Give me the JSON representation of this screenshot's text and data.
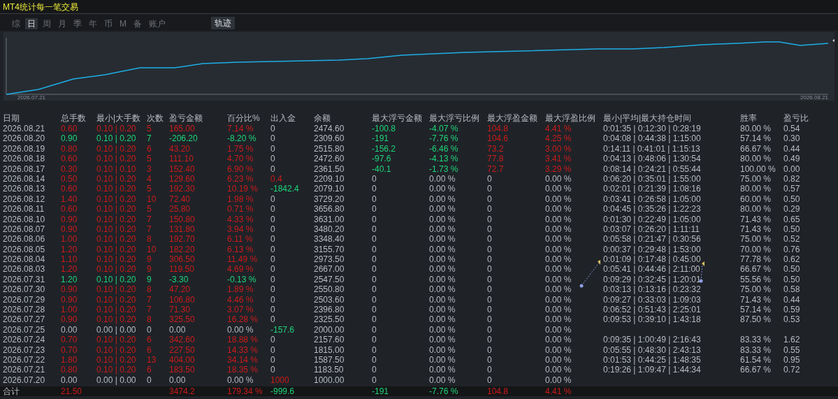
{
  "window": {
    "title": "MT4统计每一笔交易"
  },
  "tabs": [
    {
      "label": "综",
      "selected": false
    },
    {
      "label": "日",
      "selected": true
    },
    {
      "label": "周",
      "selected": false
    },
    {
      "label": "月",
      "selected": false
    },
    {
      "label": "季",
      "selected": false
    },
    {
      "label": "年",
      "selected": false
    },
    {
      "label": "币",
      "selected": false
    },
    {
      "label": "M",
      "selected": false
    },
    {
      "label": "备",
      "selected": false
    },
    {
      "label": "账户",
      "selected": false
    }
  ],
  "view_tabs": [
    {
      "label": "轨迹",
      "selected": true
    }
  ],
  "equity_chart": {
    "start_label": "2026.07.21",
    "end_label": "2026.08.21"
  },
  "table": {
    "columns": [
      "日期",
      "总手数",
      "最小|大手数",
      "次数",
      "盈亏金额",
      "百分比%",
      "出入金",
      "余额",
      "最大浮亏金额",
      "最大浮亏比例",
      "最大浮盈金额",
      "最大浮盈比例",
      "最小|平均|最大持仓时间",
      "胜率",
      "盈亏比"
    ],
    "rows": [
      {
        "date": "2026.08.21",
        "color": "#cc1a1a",
        "lots": "0.60",
        "minmax": "0.10 | 0.20",
        "count": "5",
        "pnl": "165.00",
        "pct": "7.14 %",
        "cash": {
          "text": "0"
        },
        "balance": "2474.60",
        "float_loss": {
          "amount": "-100.8",
          "ratio": "-4.07 %",
          "color": "#1ed47a"
        },
        "float_gain": {
          "amount": "104.8",
          "ratio": "4.41 %",
          "color": "#cc1a1a"
        },
        "hold": "0:01:35 | 0:12:30 | 0:28:19",
        "win": "80.00 %",
        "ratio": "0.54"
      },
      {
        "date": "2026.08.20",
        "color": "#1ed47a",
        "lots": "0.90",
        "minmax": "0.10 | 0.20",
        "count": "7",
        "pnl": "-206.20",
        "pct": "-8.20 %",
        "cash": {
          "text": "0"
        },
        "balance": "2309.60",
        "float_loss": {
          "amount": "-191",
          "ratio": "-7.76 %",
          "color": "#1ed47a"
        },
        "float_gain": {
          "amount": "104.6",
          "ratio": "4.25 %",
          "color": "#cc1a1a"
        },
        "hold": "0:04:08 | 0:44:38 | 1:15:00",
        "win": "57.14 %",
        "ratio": "0.30"
      },
      {
        "date": "2026.08.19",
        "color": "#cc1a1a",
        "lots": "0.80",
        "minmax": "0.10 | 0.20",
        "count": "6",
        "pnl": "43.20",
        "pct": "1.75 %",
        "cash": {
          "text": "0"
        },
        "balance": "2515.80",
        "float_loss": {
          "amount": "-156.2",
          "ratio": "-6.46 %",
          "color": "#1ed47a"
        },
        "float_gain": {
          "amount": "73.2",
          "ratio": "3.00 %",
          "color": "#cc1a1a"
        },
        "hold": "0:14:11 | 0:41:01 | 1:15:13",
        "win": "66.67 %",
        "ratio": "0.44"
      },
      {
        "date": "2026.08.18",
        "color": "#cc1a1a",
        "lots": "0.60",
        "minmax": "0.10 | 0.20",
        "count": "5",
        "pnl": "111.10",
        "pct": "4.70 %",
        "cash": {
          "text": "0"
        },
        "balance": "2472.60",
        "float_loss": {
          "amount": "-97.6",
          "ratio": "-4.13 %",
          "color": "#1ed47a"
        },
        "float_gain": {
          "amount": "77.8",
          "ratio": "3.41 %",
          "color": "#cc1a1a"
        },
        "hold": "0:04:13 | 0:48:06 | 1:30:54",
        "win": "80.00 %",
        "ratio": "0.49"
      },
      {
        "date": "2026.08.17",
        "color": "#cc1a1a",
        "lots": "0.30",
        "minmax": "0.10 | 0.10",
        "count": "3",
        "pnl": "152.40",
        "pct": "6.90 %",
        "cash": {
          "text": "0"
        },
        "balance": "2361.50",
        "float_loss": {
          "amount": "-40.1",
          "ratio": "-1.73 %",
          "color": "#1ed47a"
        },
        "float_gain": {
          "amount": "72.7",
          "ratio": "3.29 %",
          "color": "#cc1a1a"
        },
        "hold": "0:08:14 | 0:24:21 | 0:55:44",
        "win": "100.00 %",
        "ratio": "0.00"
      },
      {
        "date": "2026.08.14",
        "color": "#cc1a1a",
        "lots": "0.50",
        "minmax": "0.10 | 0.20",
        "count": "4",
        "pnl": "129.60",
        "pct": "6.23 %",
        "cash": {
          "text": "0.4",
          "color": "#cc1a1a"
        },
        "balance": "2209.10",
        "float_loss": {
          "amount": "0",
          "ratio": "0.00 %"
        },
        "float_gain": {
          "amount": "0",
          "ratio": "0.00 %"
        },
        "hold": "0:06:20 | 0:35:01 | 1:55:00",
        "win": "75.00 %",
        "ratio": "0.82"
      },
      {
        "date": "2026.08.13",
        "color": "#cc1a1a",
        "lots": "0.60",
        "minmax": "0.10 | 0.20",
        "count": "5",
        "pnl": "192.30",
        "pct": "10.19 %",
        "cash": {
          "text": "-1842.4",
          "color": "#1ed47a"
        },
        "balance": "2079.10",
        "float_loss": {
          "amount": "0",
          "ratio": "0.00 %"
        },
        "float_gain": {
          "amount": "0",
          "ratio": "0.00 %"
        },
        "hold": "0:02:01 | 0:21:39 | 1:08:16",
        "win": "80.00 %",
        "ratio": "0.57"
      },
      {
        "date": "2026.08.12",
        "color": "#cc1a1a",
        "lots": "1.40",
        "minmax": "0.10 | 0.20",
        "count": "10",
        "pnl": "72.40",
        "pct": "1.98 %",
        "cash": {
          "text": "0"
        },
        "balance": "3729.20",
        "float_loss": {
          "amount": "0",
          "ratio": "0.00 %"
        },
        "float_gain": {
          "amount": "0",
          "ratio": "0.00 %"
        },
        "hold": "0:03:41 | 0:26:58 | 1:05:00",
        "win": "60.00 %",
        "ratio": "0.50"
      },
      {
        "date": "2026.08.11",
        "color": "#cc1a1a",
        "lots": "0.60",
        "minmax": "0.10 | 0.20",
        "count": "5",
        "pnl": "25.80",
        "pct": "0.71 %",
        "cash": {
          "text": "0"
        },
        "balance": "3656.80",
        "float_loss": {
          "amount": "0",
          "ratio": "0.00 %"
        },
        "float_gain": {
          "amount": "0",
          "ratio": "0.00 %"
        },
        "hold": "0:04:45 | 0:35:26 | 1:22:23",
        "win": "80.00 %",
        "ratio": "0.29"
      },
      {
        "date": "2026.08.10",
        "color": "#cc1a1a",
        "lots": "0.90",
        "minmax": "0.10 | 0.20",
        "count": "7",
        "pnl": "150.80",
        "pct": "4.33 %",
        "cash": {
          "text": "0"
        },
        "balance": "3631.00",
        "float_loss": {
          "amount": "0",
          "ratio": "0.00 %"
        },
        "float_gain": {
          "amount": "0",
          "ratio": "0.00 %"
        },
        "hold": "0:01:30 | 0:22:49 | 1:05:00",
        "win": "71.43 %",
        "ratio": "0.65"
      },
      {
        "date": "2026.08.07",
        "color": "#cc1a1a",
        "lots": "0.90",
        "minmax": "0.10 | 0.20",
        "count": "7",
        "pnl": "131.80",
        "pct": "3.94 %",
        "cash": {
          "text": "0"
        },
        "balance": "3480.20",
        "float_loss": {
          "amount": "0",
          "ratio": "0.00 %"
        },
        "float_gain": {
          "amount": "0",
          "ratio": "0.00 %"
        },
        "hold": "0:03:07 | 0:26:20 | 1:11:11",
        "win": "71.43 %",
        "ratio": "0.50"
      },
      {
        "date": "2026.08.06",
        "color": "#cc1a1a",
        "lots": "1.00",
        "minmax": "0.10 | 0.20",
        "count": "8",
        "pnl": "192.70",
        "pct": "6.11 %",
        "cash": {
          "text": "0"
        },
        "balance": "3348.40",
        "float_loss": {
          "amount": "0",
          "ratio": "0.00 %"
        },
        "float_gain": {
          "amount": "0",
          "ratio": "0.00 %"
        },
        "hold": "0:05:58 | 0:21:47 | 0:30:56",
        "win": "75.00 %",
        "ratio": "0.52"
      },
      {
        "date": "2026.08.05",
        "color": "#cc1a1a",
        "lots": "1.20",
        "minmax": "0.10 | 0.20",
        "count": "10",
        "pnl": "182.20",
        "pct": "6.13 %",
        "cash": {
          "text": "0"
        },
        "balance": "3155.70",
        "float_loss": {
          "amount": "0",
          "ratio": "0.00 %"
        },
        "float_gain": {
          "amount": "0",
          "ratio": "0.00 %"
        },
        "hold": "0:00:37 | 0:29:48 | 1:53:00",
        "win": "70.00 %",
        "ratio": "0.76"
      },
      {
        "date": "2026.08.04",
        "color": "#cc1a1a",
        "lots": "1.10",
        "minmax": "0.10 | 0.20",
        "count": "9",
        "pnl": "306.50",
        "pct": "11.49 %",
        "cash": {
          "text": "0"
        },
        "balance": "2973.50",
        "float_loss": {
          "amount": "0",
          "ratio": "0.00 %"
        },
        "float_gain": {
          "amount": "0",
          "ratio": "0.00 %"
        },
        "hold": "0:01:09 | 0:17:48 | 0:45:00",
        "win": "77.78 %",
        "ratio": "0.62"
      },
      {
        "date": "2026.08.03",
        "color": "#cc1a1a",
        "lots": "1.20",
        "minmax": "0.10 | 0.20",
        "count": "9",
        "pnl": "119.50",
        "pct": "4.69 %",
        "cash": {
          "text": "0"
        },
        "balance": "2667.00",
        "float_loss": {
          "amount": "0",
          "ratio": "0.00 %"
        },
        "float_gain": {
          "amount": "0",
          "ratio": "0.00 %"
        },
        "hold": "0:05:41 | 0:44:46 | 2:11:00",
        "win": "66.67 %",
        "ratio": "0.50"
      },
      {
        "date": "2026.07.31",
        "color": "#1ed47a",
        "lots": "1.20",
        "minmax": "0.10 | 0.20",
        "count": "9",
        "pnl": "-3.30",
        "pct": "-0.13 %",
        "cash": {
          "text": "0"
        },
        "balance": "2547.50",
        "float_loss": {
          "amount": "0",
          "ratio": "0.00 %"
        },
        "float_gain": {
          "amount": "0",
          "ratio": "0.00 %"
        },
        "hold": "0:09:29 | 0:32:45 | 1:20:01",
        "win": "55.56 %",
        "ratio": "0.50"
      },
      {
        "date": "2026.07.30",
        "color": "#cc1a1a",
        "lots": "0.90",
        "minmax": "0.10 | 0.20",
        "count": "8",
        "pnl": "47.20",
        "pct": "1.89 %",
        "cash": {
          "text": "0"
        },
        "balance": "2550.80",
        "float_loss": {
          "amount": "0",
          "ratio": "0.00 %"
        },
        "float_gain": {
          "amount": "0",
          "ratio": "0.00 %"
        },
        "hold": "0:03:13 | 0:13:16 | 0:23:32",
        "win": "75.00 %",
        "ratio": "0.58"
      },
      {
        "date": "2026.07.29",
        "color": "#cc1a1a",
        "lots": "0.90",
        "minmax": "0.10 | 0.20",
        "count": "7",
        "pnl": "106.80",
        "pct": "4.46 %",
        "cash": {
          "text": "0"
        },
        "balance": "2503.60",
        "float_loss": {
          "amount": "0",
          "ratio": "0.00 %"
        },
        "float_gain": {
          "amount": "0",
          "ratio": "0.00 %"
        },
        "hold": "0:09:27 | 0:33:03 | 1:09:03",
        "win": "71.43 %",
        "ratio": "0.44"
      },
      {
        "date": "2026.07.28",
        "color": "#cc1a1a",
        "lots": "1.00",
        "minmax": "0.10 | 0.20",
        "count": "7",
        "pnl": "71.30",
        "pct": "3.07 %",
        "cash": {
          "text": "0"
        },
        "balance": "2396.80",
        "float_loss": {
          "amount": "0",
          "ratio": "0.00 %"
        },
        "float_gain": {
          "amount": "0",
          "ratio": "0.00 %"
        },
        "hold": "0:06:52 | 0:51:43 | 2:25:01",
        "win": "57.14 %",
        "ratio": "0.59"
      },
      {
        "date": "2026.07.27",
        "color": "#cc1a1a",
        "lots": "0.90",
        "minmax": "0.10 | 0.20",
        "count": "8",
        "pnl": "325.50",
        "pct": "16.28 %",
        "cash": {
          "text": "0"
        },
        "balance": "2325.50",
        "float_loss": {
          "amount": "0",
          "ratio": "0.00 %"
        },
        "float_gain": {
          "amount": "0",
          "ratio": "0.00 %"
        },
        "hold": "0:09:53 | 0:39:10 | 1:43:18",
        "win": "87.50 %",
        "ratio": "0.53"
      },
      {
        "date": "2026.07.25",
        "color": "#b8bcc2",
        "lots": "0.00",
        "minmax": "0.00 | 0.00",
        "count": "0",
        "pnl": "0.00",
        "pct": "0.00 %",
        "cash": {
          "text": "-157.6",
          "color": "#1ed47a"
        },
        "balance": "2000.00",
        "float_loss": {
          "amount": "0",
          "ratio": "0.00 %"
        },
        "float_gain": {
          "amount": "0",
          "ratio": "0.00 %"
        }
      },
      {
        "date": "2026.07.24",
        "color": "#cc1a1a",
        "lots": "0.70",
        "minmax": "0.10 | 0.20",
        "count": "6",
        "pnl": "342.60",
        "pct": "18.88 %",
        "cash": {
          "text": "0"
        },
        "balance": "2157.60",
        "float_loss": {
          "amount": "0",
          "ratio": "0.00 %"
        },
        "float_gain": {
          "amount": "0",
          "ratio": "0.00 %"
        },
        "hold": "0:09:35 | 1:00:49 | 2:16:43",
        "win": "83.33 %",
        "ratio": "1.62"
      },
      {
        "date": "2026.07.23",
        "color": "#cc1a1a",
        "lots": "0.70",
        "minmax": "0.10 | 0.20",
        "count": "6",
        "pnl": "227.50",
        "pct": "14.33 %",
        "cash": {
          "text": "0"
        },
        "balance": "1815.00",
        "float_loss": {
          "amount": "0",
          "ratio": "0.00 %"
        },
        "float_gain": {
          "amount": "0",
          "ratio": "0.00 %"
        },
        "hold": "0:05:55 | 0:48:30 | 2:43:13",
        "win": "83.33 %",
        "ratio": "0.55"
      },
      {
        "date": "2026.07.22",
        "color": "#cc1a1a",
        "lots": "1.80",
        "minmax": "0.10 | 0.20",
        "count": "13",
        "pnl": "404.00",
        "pct": "34.14 %",
        "cash": {
          "text": "0"
        },
        "balance": "1587.50",
        "float_loss": {
          "amount": "0",
          "ratio": "0.00 %"
        },
        "float_gain": {
          "amount": "0",
          "ratio": "0.00 %"
        },
        "hold": "0:01:53 | 0:44:25 | 1:48:35",
        "win": "61.54 %",
        "ratio": "0.95"
      },
      {
        "date": "2026.07.21",
        "color": "#cc1a1a",
        "lots": "0.80",
        "minmax": "0.10 | 0.20",
        "count": "6",
        "pnl": "183.50",
        "pct": "18.35 %",
        "cash": {
          "text": "0"
        },
        "balance": "1183.50",
        "float_loss": {
          "amount": "0",
          "ratio": "0.00 %"
        },
        "float_gain": {
          "amount": "0",
          "ratio": "0.00 %"
        },
        "hold": "0:19:26 | 1:09:47 | 1:44:34",
        "win": "66.67 %",
        "ratio": "0.72"
      },
      {
        "date": "2026.07.20",
        "color": "#b8bcc2",
        "lots": "0.00",
        "minmax": "0.00 | 0.00",
        "count": "0",
        "pnl": "0.00",
        "pct": "0.00 %",
        "cash": {
          "text": "1000",
          "color": "#cc1a1a"
        },
        "balance": "1000.00",
        "float_loss": {
          "amount": "0",
          "ratio": "0.00 %"
        },
        "float_gain": {
          "amount": "0",
          "ratio": "0.00 %"
        }
      }
    ],
    "total": {
      "label": "合计",
      "color": "#cc1a1a",
      "lots": "21.50",
      "pnl": "3474.2",
      "pct": "179.34 %",
      "cash": {
        "text": "-999.6",
        "color": "#1ed47a"
      },
      "float_loss": {
        "amount": "-191",
        "ratio": "-7.76 %",
        "color": "#1ed47a"
      },
      "float_gain": {
        "amount": "104.8",
        "ratio": "4.41 %",
        "color": "#cc1a1a"
      }
    }
  }
}
